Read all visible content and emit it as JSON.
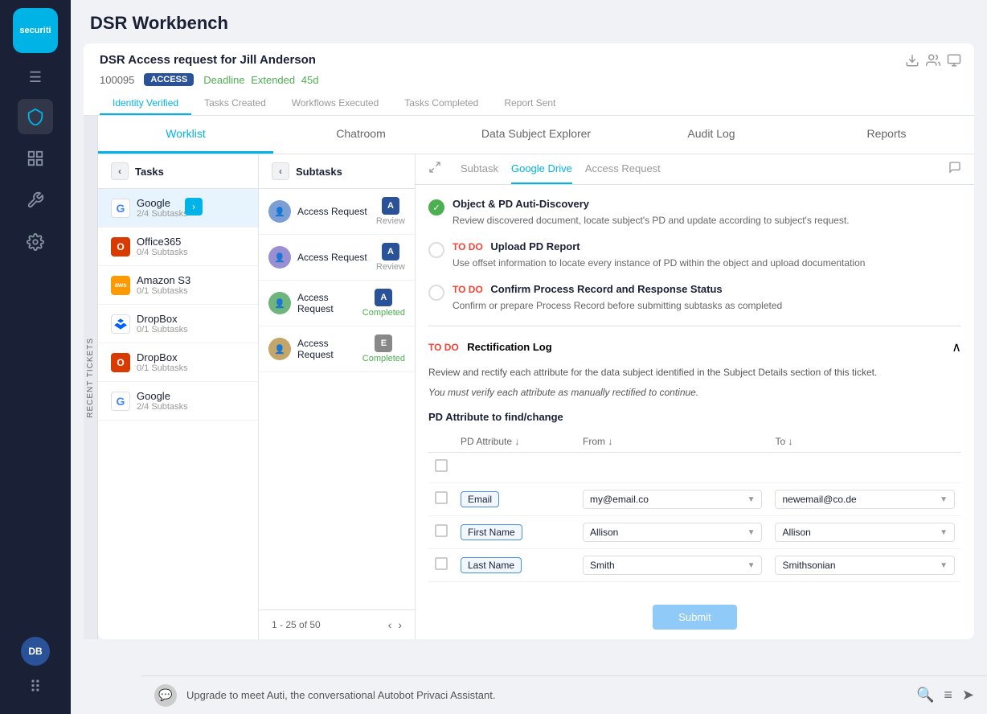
{
  "app": {
    "logo": "securiti",
    "title": "DSR Workbench"
  },
  "sidebar": {
    "icons": [
      "☰",
      "⊞",
      "🔧",
      "⚙"
    ],
    "bottom_avatar": "DB",
    "bottom_grid": "⠿"
  },
  "dsr_header": {
    "title": "DSR Access request for Jill Anderson",
    "id": "100095",
    "badge": "ACCESS",
    "deadline_label": "Deadline",
    "deadline_status": "Extended",
    "deadline_days": "45d",
    "tabs": [
      "Identity Verified",
      "Tasks Created",
      "Workflows Executed",
      "Tasks Completed",
      "Report Sent"
    ],
    "active_tab": 0
  },
  "main_tabs": {
    "tabs": [
      "Worklist",
      "Chatroom",
      "Data Subject Explorer",
      "Audit Log",
      "Reports"
    ],
    "active_tab": 0
  },
  "tasks_panel": {
    "header": "Tasks",
    "items": [
      {
        "icon": "G",
        "icon_type": "google",
        "name": "Google",
        "sub": "2/4 Subtasks"
      },
      {
        "icon": "O",
        "icon_type": "office",
        "name": "Office365",
        "sub": "0/4 Subtasks"
      },
      {
        "icon": "aws",
        "icon_type": "aws",
        "name": "Amazon S3",
        "sub": "0/1 Subtasks"
      },
      {
        "icon": "D",
        "icon_type": "dropbox",
        "name": "DropBox",
        "sub": "0/1 Subtasks"
      },
      {
        "icon": "D",
        "icon_type": "office",
        "name": "DropBox",
        "sub": "0/1 Subtasks"
      },
      {
        "icon": "G",
        "icon_type": "google",
        "name": "Google",
        "sub": "2/4 Subtasks"
      }
    ]
  },
  "subtasks_panel": {
    "header": "Subtasks",
    "items": [
      {
        "label": "Access Request",
        "badge": "A",
        "status": "Review"
      },
      {
        "label": "Access Request",
        "badge": "A",
        "status": "Review"
      },
      {
        "label": "Access Request",
        "badge": "A",
        "status": "Completed"
      },
      {
        "label": "Access Request",
        "badge": "E",
        "status": "Completed"
      }
    ],
    "pagination": "1 - 25 of 50"
  },
  "detail_panel": {
    "tabs": [
      "Subtask",
      "Google Drive",
      "Access Request"
    ],
    "active_tab": 1,
    "tasks": [
      {
        "status": "done",
        "title": "Object & PD Auti-Discovery",
        "desc": "Review discovered document, locate subject's PD and update according to subject's request."
      },
      {
        "status": "todo",
        "todo_label": "TO DO",
        "title": "Upload PD Report",
        "desc": "Use offset information to locate every instance of PD within the object and upload documentation"
      },
      {
        "status": "todo",
        "todo_label": "TO DO",
        "title": "Confirm Process Record and Response Status",
        "desc": "Confirm or prepare Process Record before submitting subtasks as completed"
      }
    ],
    "rectification": {
      "todo_label": "TO DO",
      "title": "Rectification Log",
      "desc": "Review and rectify each attribute for the data subject identified in the Subject Details section of this ticket.",
      "note": "You must verify each attribute as manually rectified to continue.",
      "pd_section_title": "PD Attribute to find/change",
      "table_headers": [
        "PD Attribute ↓",
        "From ↓",
        "To ↓"
      ],
      "rows": [
        {
          "attr": "Email",
          "from": "my@email.co",
          "to": "newemail@co.de"
        },
        {
          "attr": "First Name",
          "from": "Allison",
          "to": "Allison"
        },
        {
          "attr": "Last Name",
          "from": "Smith",
          "to": "Smithsonian"
        }
      ],
      "submit_label": "Submit"
    }
  },
  "bottom_bar": {
    "text": "Upgrade to meet Auti, the conversational Autobot Privaci Assistant.",
    "icons": [
      "🔍",
      "≡",
      "➤"
    ]
  },
  "colors": {
    "accent": "#00b3e6",
    "sidebar_bg": "#1a2035",
    "active_blue": "#00b3e6",
    "todo_red": "#f44336",
    "done_green": "#4caf50",
    "submit_blue": "#90caf9"
  }
}
